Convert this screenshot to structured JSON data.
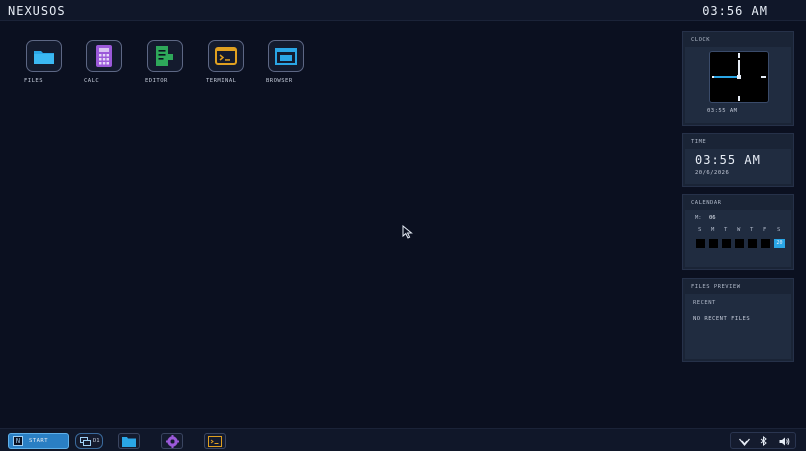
{
  "topbar": {
    "brand": "NEXUSOS",
    "time": "03:56 AM"
  },
  "desktop_icons": [
    {
      "label": "FILES",
      "icon": "folder-icon",
      "color": "#2aa6e6"
    },
    {
      "label": "CALC",
      "icon": "calculator-icon",
      "color": "#9b59d9"
    },
    {
      "label": "EDITOR",
      "icon": "document-edit-icon",
      "color": "#2ea85a"
    },
    {
      "label": "TERMINAL",
      "icon": "terminal-icon",
      "color": "#e0a020"
    },
    {
      "label": "BROWSER",
      "icon": "browser-window-icon",
      "color": "#2aa6e6"
    }
  ],
  "widgets": {
    "clock": {
      "title": "CLOCK",
      "time": "03:55 AM"
    },
    "time": {
      "title": "TIME",
      "time": "03:55 AM",
      "date": "20/6/2026"
    },
    "calendar": {
      "title": "CALENDAR",
      "month_prefix": "M:",
      "month": "06",
      "weekdays": [
        "S",
        "M",
        "T",
        "W",
        "T",
        "F",
        "S"
      ],
      "today": "20"
    },
    "files_preview": {
      "title": "FILES PREVIEW",
      "section": "RECENT",
      "empty_text": "NO RECENT FILES"
    }
  },
  "taskbar": {
    "start_label": "START",
    "workspace_label": "D1",
    "pinned": [
      "folder-icon",
      "gear-icon",
      "terminal-icon"
    ],
    "tray_icons": [
      "wifi-icon",
      "bluetooth-icon",
      "volume-icon"
    ]
  },
  "colors": {
    "accent": "#2aa6e6",
    "background": "#0b1020",
    "panel": "#1a2436"
  }
}
